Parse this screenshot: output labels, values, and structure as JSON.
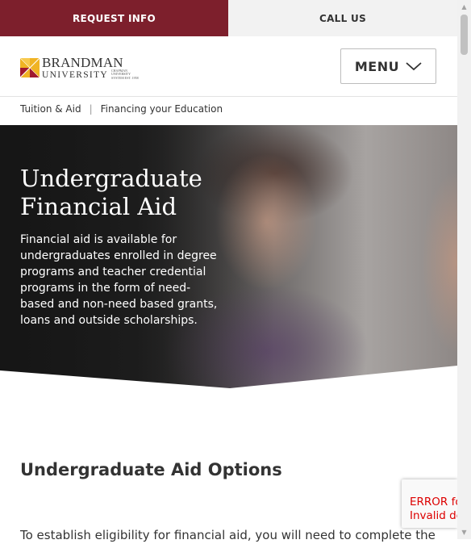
{
  "topbar": {
    "request_info": "REQUEST INFO",
    "call_us": "CALL US"
  },
  "header": {
    "logo": {
      "name": "BRANDMAN",
      "sub": "UNIVERSITY",
      "tagline": "CHAPMAN UNIVERSITY SYSTEM EST. 1958"
    },
    "menu_label": "MENU"
  },
  "breadcrumb": {
    "items": [
      "Tuition & Aid",
      "Financing your Education"
    ],
    "separator": "|"
  },
  "hero": {
    "title": "Undergraduate Financial Aid",
    "description": "Financial aid is available for undergraduates enrolled in degree programs and teacher credential programs in the form of need-based and non-need based grants, loans and outside scholarships."
  },
  "main": {
    "section_title": "Undergraduate Aid Options",
    "body_text": "To establish eligibility for financial aid, you will need to complete the"
  },
  "recaptcha": {
    "line1": "ERROR for",
    "line2": "Invalid do"
  },
  "colors": {
    "brand": "#7d1f2c",
    "logo_gold": "#f0b323",
    "logo_red": "#a0192e"
  },
  "icons": {
    "menu": "chevron-down-icon",
    "scroll_up": "scroll-up-arrow",
    "scroll_down": "scroll-down-arrow"
  }
}
